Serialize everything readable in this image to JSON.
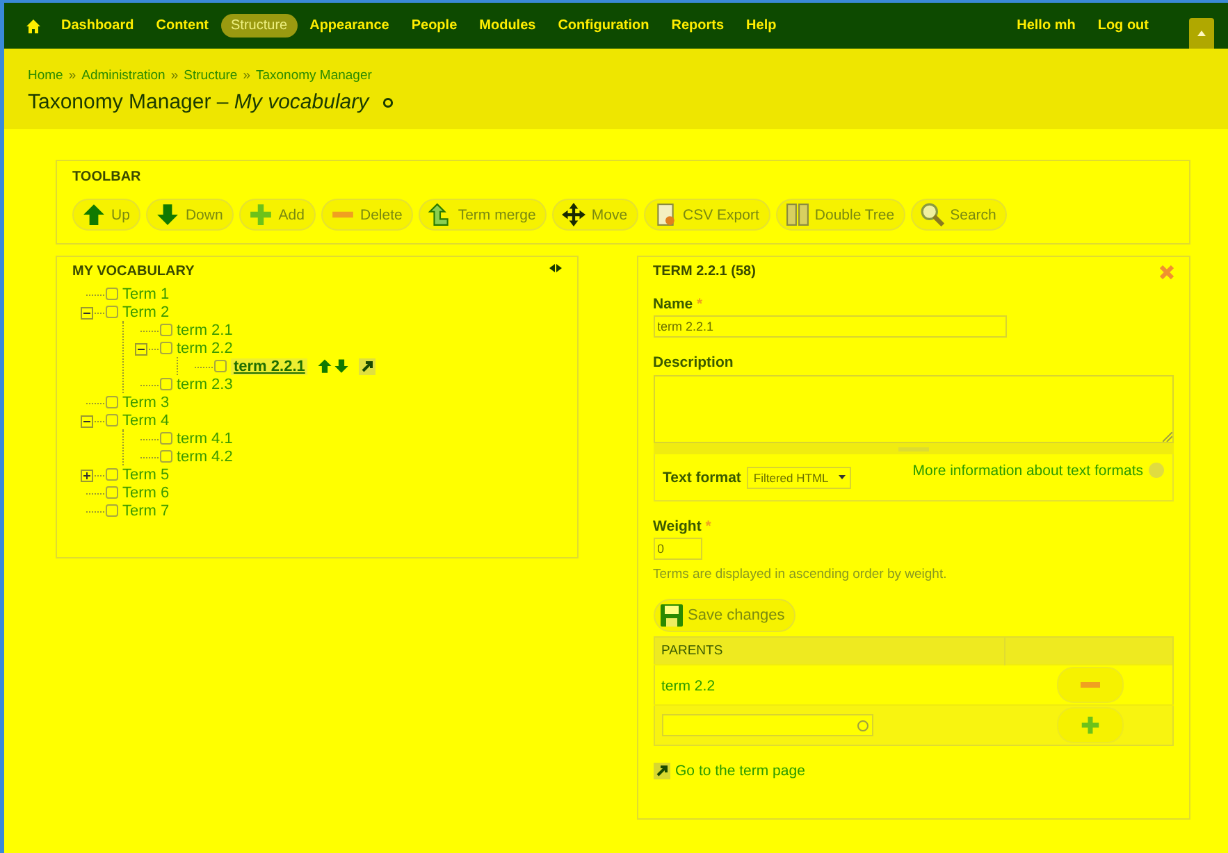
{
  "top_nav": {
    "items": [
      {
        "label": "Dashboard",
        "selected": false
      },
      {
        "label": "Content",
        "selected": false
      },
      {
        "label": "Structure",
        "selected": true
      },
      {
        "label": "Appearance",
        "selected": false
      },
      {
        "label": "People",
        "selected": false
      },
      {
        "label": "Modules",
        "selected": false
      },
      {
        "label": "Configuration",
        "selected": false
      },
      {
        "label": "Reports",
        "selected": false
      },
      {
        "label": "Help",
        "selected": false
      }
    ],
    "user_links": [
      "Hello mh",
      "Log out"
    ]
  },
  "breadcrumb": {
    "separator": "»",
    "items": [
      "Home",
      "Administration",
      "Structure",
      "Taxonomy Manager"
    ]
  },
  "page_title": "Taxonomy Manager – *My vocabulary*",
  "toolbar": {
    "title": "TOOLBAR",
    "buttons": [
      {
        "label": "Up",
        "kind": "up"
      },
      {
        "label": "Down",
        "kind": "down"
      },
      {
        "label": "Add",
        "kind": "add"
      },
      {
        "label": "Delete",
        "kind": "delete"
      },
      {
        "label": "Term merge",
        "kind": "merge"
      },
      {
        "label": "Move",
        "kind": "move"
      },
      {
        "label": "CSV Export",
        "kind": "export"
      },
      {
        "label": "Double Tree",
        "kind": "doubletree"
      },
      {
        "label": "Search",
        "kind": "search"
      }
    ]
  },
  "vocabulary": {
    "title": "MY VOCABULARY",
    "tree": [
      {
        "label": "Term 1",
        "checked": false,
        "selected": false
      },
      {
        "label": "Term 2",
        "checked": false,
        "selected": false,
        "expanded": true,
        "children": [
          {
            "label": "term 2.1",
            "checked": false,
            "selected": false
          },
          {
            "label": "term 2.2",
            "checked": false,
            "selected": false,
            "expanded": true,
            "children": [
              {
                "label": "term 2.2.1",
                "checked": false,
                "selected": true
              }
            ]
          },
          {
            "label": "term 2.3",
            "checked": false,
            "selected": false
          }
        ]
      },
      {
        "label": "Term 3",
        "checked": false,
        "selected": false
      },
      {
        "label": "Term 4",
        "checked": false,
        "selected": false,
        "expanded": true,
        "children": [
          {
            "label": "term 4.1",
            "checked": false,
            "selected": false
          },
          {
            "label": "term 4.2",
            "checked": false,
            "selected": false
          }
        ]
      },
      {
        "label": "Term 5",
        "checked": false,
        "selected": false,
        "expanded": false
      },
      {
        "label": "Term 6",
        "checked": false,
        "selected": false
      },
      {
        "label": "Term 7",
        "checked": false,
        "selected": false
      }
    ]
  },
  "term_form": {
    "title": "TERM 2.2.1 (58)",
    "name": {
      "label": "Name",
      "required_mark": "*",
      "value": "term 2.2.1"
    },
    "description": {
      "label": "Description"
    },
    "text_format": {
      "label": "Text format",
      "value": "Filtered HTML",
      "help_link": "More information about text formats"
    },
    "weight": {
      "label": "Weight",
      "required_mark": "*",
      "value": "0",
      "help": "Terms are displayed in ascending order by weight."
    },
    "save_button": "Save changes",
    "parents": {
      "header": "PARENTS",
      "rows": [
        "term 2.2"
      ]
    },
    "term_page_link": "Go to the term page"
  }
}
